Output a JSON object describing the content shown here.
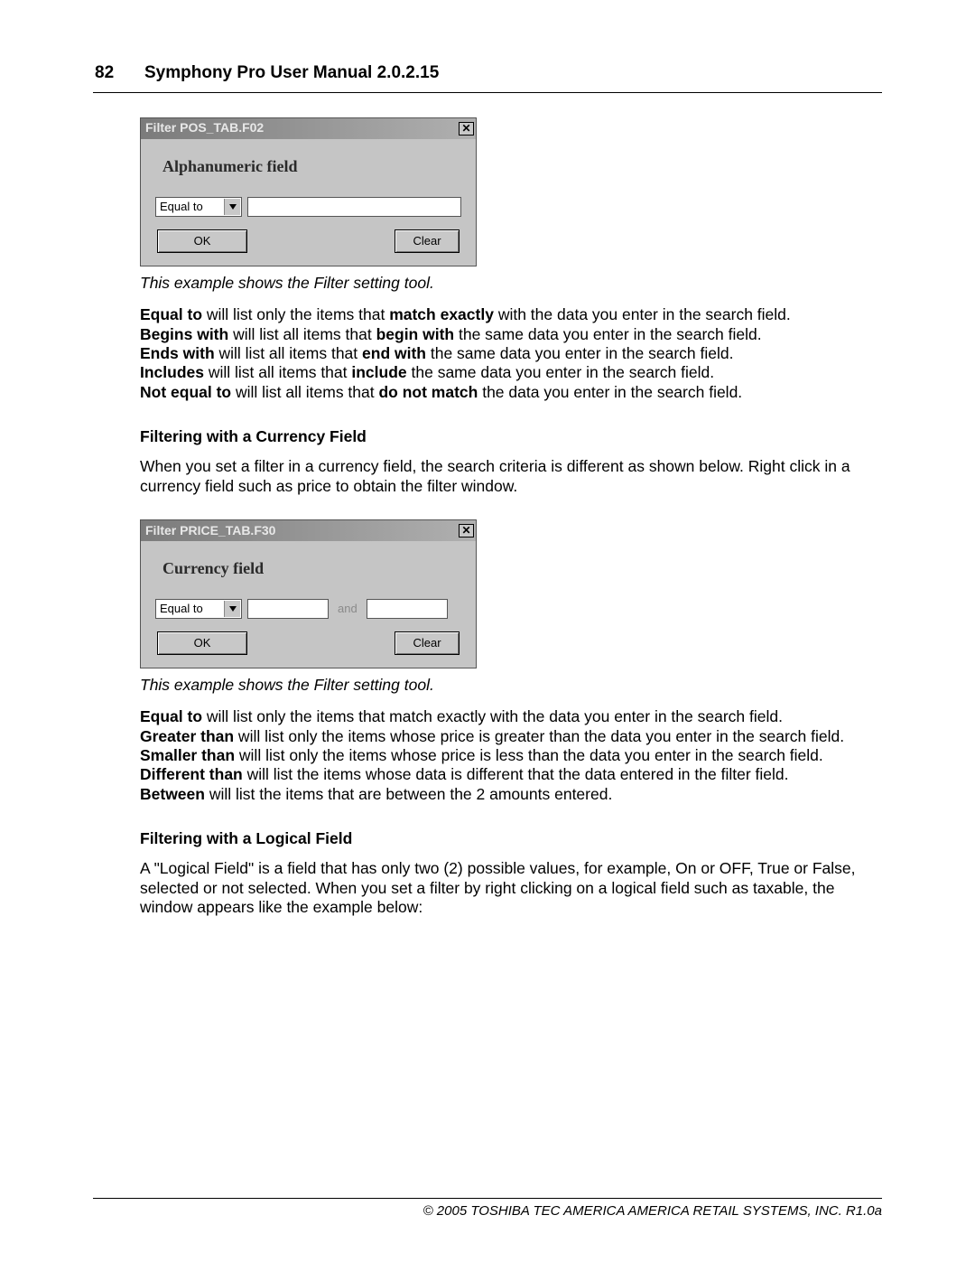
{
  "header": {
    "page_number": "82",
    "manual_title": "Symphony Pro User Manual  2.0.2.15"
  },
  "dialog1": {
    "title": "Filter POS_TAB.F02",
    "field_label": "Alphanumeric field",
    "operator": "Equal to",
    "ok": "OK",
    "clear": "Clear"
  },
  "caption1": "This example shows the Filter setting tool.",
  "alpha_ops": [
    {
      "term": "Equal to",
      "desc_pre": " will list only the items that ",
      "mid_bold": "match exactly",
      "desc_post": " with the data you enter in the search field."
    },
    {
      "term": "Begins with",
      "desc_pre": " will list all items that ",
      "mid_bold": "begin with",
      "desc_post": " the same data you enter in the search field."
    },
    {
      "term": "Ends with",
      "desc_pre": " will list all items that ",
      "mid_bold": "end with",
      "desc_post": " the same data you enter in the search field."
    },
    {
      "term": "Includes",
      "desc_pre": " will list all items that ",
      "mid_bold": "include",
      "desc_post": " the same data you enter in the search field."
    },
    {
      "term": "Not equal to",
      "desc_pre": " will list all items that ",
      "mid_bold": "do not match",
      "desc_post": " the data you enter in the search field."
    }
  ],
  "section_currency": "Filtering with a Currency Field",
  "currency_intro": "When you set a filter in a currency field, the search criteria is different as shown below. Right click in a currency field such as price to obtain the filter window.",
  "dialog2": {
    "title": "Filter PRICE_TAB.F30",
    "field_label": "Currency field",
    "operator": "Equal to",
    "and": "and",
    "ok": "OK",
    "clear": "Clear"
  },
  "caption2": "This example shows the Filter setting tool.",
  "currency_ops": [
    {
      "term": "Equal to",
      "desc": " will list only the items that match exactly with the data you enter in the search field."
    },
    {
      "term": "Greater than",
      "desc": " will list only the items whose price is greater than the data you enter in the search field."
    },
    {
      "term": "Smaller than",
      "desc": " will list only the items whose price is less than the data you enter in the search field."
    },
    {
      "term": "Different than",
      "desc": " will list the items whose data is different that the data entered in the filter field."
    },
    {
      "term": "Between",
      "desc": " will list the items that are between the 2 amounts entered."
    }
  ],
  "section_logical": "Filtering with a Logical Field",
  "logical_intro": "A \"Logical Field\" is a field that has only two (2) possible values, for example, On or OFF, True or False, selected or not selected. When you set a filter by right clicking on a logical field such as taxable, the window appears like the example below:",
  "footer": "© 2005 TOSHIBA TEC AMERICA AMERICA RETAIL SYSTEMS, INC.   R1.0a"
}
